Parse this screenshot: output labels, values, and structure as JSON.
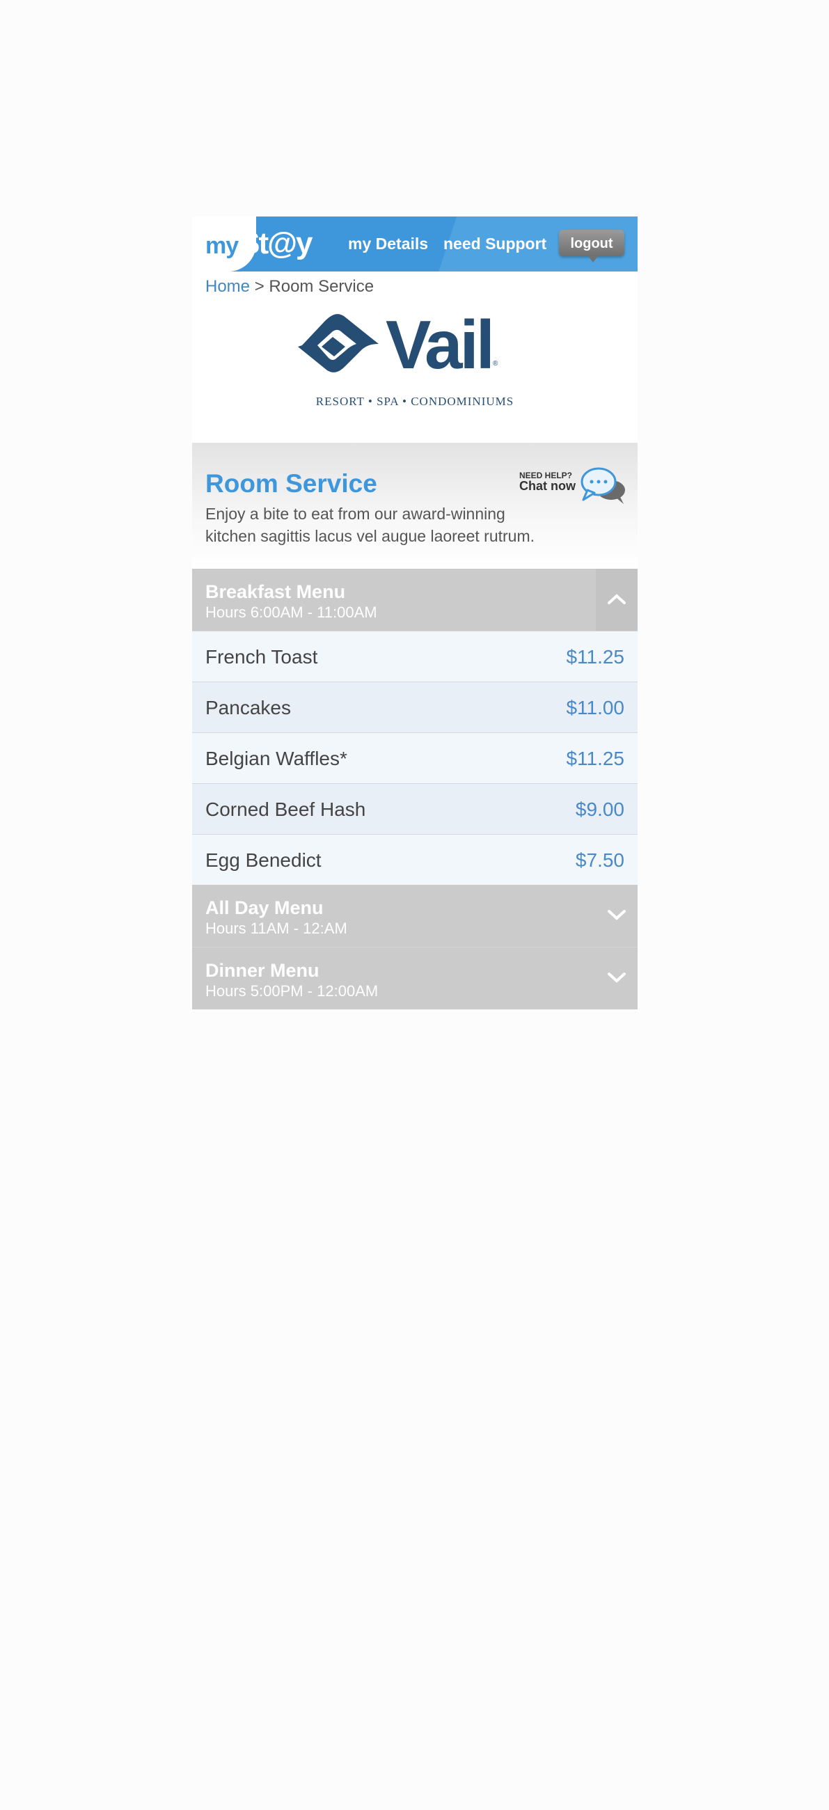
{
  "header": {
    "logo_my": "my",
    "logo_stay": "St@y",
    "nav_details": "my Details",
    "nav_support": "need Support",
    "logout": "logout"
  },
  "breadcrumb": {
    "home": "Home",
    "separator": ">",
    "current": "Room Service"
  },
  "brand": {
    "name": "Vail",
    "registered": "®",
    "tagline": "RESORT • SPA • CONDOMINIUMS",
    "color": "#264e75"
  },
  "intro": {
    "title": "Room Service",
    "description": "Enjoy a bite to eat from our award-winning kitchen sagittis lacus vel augue laoreet rutrum.",
    "chat_need_help": "NEED HELP?",
    "chat_now": "Chat now"
  },
  "menus": [
    {
      "title": "Breakfast Menu",
      "hours": "Hours 6:00AM - 11:00AM",
      "expanded": true,
      "items": [
        {
          "name": "French Toast",
          "price": "$11.25"
        },
        {
          "name": "Pancakes",
          "price": "$11.00"
        },
        {
          "name": "Belgian Waffles*",
          "price": "$11.25"
        },
        {
          "name": "Corned Beef Hash",
          "price": "$9.00"
        },
        {
          "name": "Egg Benedict",
          "price": "$7.50"
        }
      ]
    },
    {
      "title": "All Day Menu",
      "hours": "Hours 11AM - 12:AM",
      "expanded": false
    },
    {
      "title": "Dinner Menu",
      "hours": "Hours 5:00PM - 12:00AM",
      "expanded": false
    }
  ],
  "colors": {
    "accent": "#3e97da",
    "price": "#4a89c6",
    "menu_header": "#cbcbcb"
  }
}
